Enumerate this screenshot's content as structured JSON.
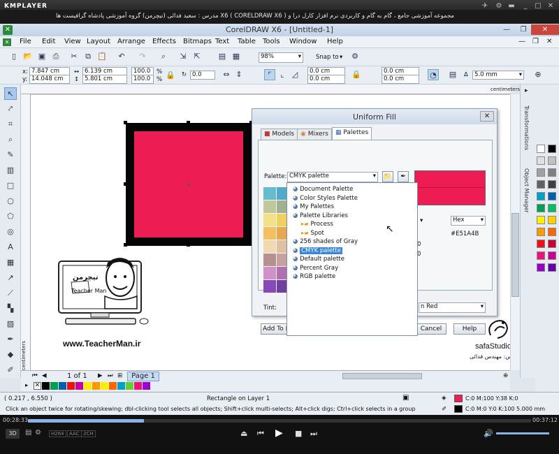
{
  "km": {
    "logo": "KMPLAYER",
    "title": "مجموعه آموزشی جامع ، گام به گام و کاربردی نرم افزار کارل درا و X6 ( CORELDRAW X6 )  مدرس : سعید فدائی (تیچرمن) گروه آموزشی پادشاه گرافیست ها",
    "time_current": "00:28:33",
    "time_total": "00:37:12",
    "badges": [
      "H264",
      "AAC",
      "2CH"
    ],
    "progress": 0.23
  },
  "cd": {
    "title": "CorelDRAW X6 - [Untitled-1]",
    "menu": [
      "File",
      "Edit",
      "View",
      "Layout",
      "Arrange",
      "Effects",
      "Bitmaps",
      "Text",
      "Table",
      "Tools",
      "Window",
      "Help"
    ],
    "zoom": "98%",
    "snap": "Snap to",
    "x": "7.847 cm",
    "y": "14.048 cm",
    "w": "6.139 cm",
    "h": "5.801 cm",
    "sx": "100.0",
    "sy": "100.0",
    "pct": "%",
    "angle": "0.0",
    "c1": "0.0 cm",
    "c2": "0.0 cm",
    "c3": "0.0 cm",
    "c4": "0.0 cm",
    "outline": "5.0 mm",
    "units": "centimeters",
    "page_count": "1 of 1",
    "page_tab": "Page 1",
    "coords": "( 0.217 , 6.550 )",
    "object_info": "Rectangle on Layer 1",
    "hint": "Click an object twice for rotating/skewing; dbl-clicking tool selects all objects; Shift+click multi-selects; Alt+click digs; Ctrl+click selects in a group",
    "fill_info": "C:0 M:100 Y:38 K:0",
    "outline_info": "C:0 M:0 Y:0 K:100  5.000 mm",
    "docker_tabs": [
      "Transformations",
      "Object Manager"
    ]
  },
  "dialog": {
    "title": "Uniform Fill",
    "tabs": [
      "Models",
      "Mixers",
      "Palettes"
    ],
    "palette_label": "Palette:",
    "palette_value": "CMYK palette",
    "hex_mode": "Hex",
    "hex_value": "#E51A4B",
    "tint_label": "Tint:",
    "name_value": "n Red",
    "add_button": "Add To P",
    "cancel": "Cancel",
    "help": "Help",
    "fragments": [
      "0",
      "0"
    ],
    "fill_color": "#ed1c52"
  },
  "dropdown": [
    {
      "label": "Document Palette",
      "indent": 0
    },
    {
      "label": "Color Styles Palette",
      "indent": 0
    },
    {
      "label": "My Palettes",
      "indent": 0
    },
    {
      "label": "Palette Libraries",
      "indent": 0
    },
    {
      "label": "Process",
      "indent": 1
    },
    {
      "label": "Spot",
      "indent": 1
    },
    {
      "label": "256 shades of Gray",
      "indent": 0
    },
    {
      "label": "CMYK palette",
      "indent": 0,
      "selected": true
    },
    {
      "label": "Default palette",
      "indent": 0
    },
    {
      "label": "Percent Gray",
      "indent": 0
    },
    {
      "label": "RGB palette",
      "indent": 0
    }
  ],
  "branding": {
    "teacher_site": "www.TeacherMan.ir",
    "teacher_name": "Teacher Man",
    "teacher_fa": "تیچرمن",
    "safa": "safaStudio.ir",
    "safa_fa": "مدرس: مهندس فدائی"
  },
  "colors": {
    "swatches": [
      "#66bbcc",
      "#50aacc",
      "#c0c89a",
      "#a0b090",
      "#f5e08a",
      "#f0d060",
      "#f5c060",
      "#e8a850",
      "#f0d8b0",
      "#e0c0a0",
      "#b89090",
      "#c8a0a0",
      "#d090c8",
      "#b070b0",
      "#8848b8",
      "#7040a0"
    ],
    "palette": [
      "#ffffff",
      "#000000",
      "#e0e0e0",
      "#c0c0c0",
      "#a0a0a0",
      "#808080",
      "#606060",
      "#404040",
      "#00a0c8",
      "#0060b0",
      "#00a050",
      "#00c060",
      "#ffee00",
      "#ffd000",
      "#ff9900",
      "#ff6600",
      "#ee1111",
      "#cc0033",
      "#ee1177",
      "#cc0099",
      "#9900cc",
      "#6600aa"
    ],
    "palbar": [
      "#000000",
      "#00a050",
      "#0060b0",
      "#ee1111",
      "#cc0099",
      "#ffee00",
      "#ff9900",
      "#ffee00",
      "#ff6600",
      "#00a0c8",
      "#66cc33",
      "#ee1177",
      "#9900cc"
    ]
  }
}
